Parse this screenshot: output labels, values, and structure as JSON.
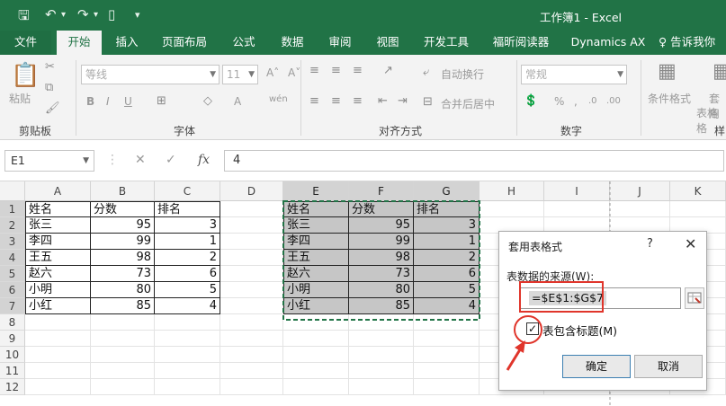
{
  "window": {
    "title": "工作簿1 - Excel"
  },
  "tabs": [
    {
      "label": "文件",
      "active": false,
      "file": true
    },
    {
      "label": "开始",
      "active": true
    },
    {
      "label": "插入"
    },
    {
      "label": "页面布局"
    },
    {
      "label": "公式"
    },
    {
      "label": "数据"
    },
    {
      "label": "审阅"
    },
    {
      "label": "视图"
    },
    {
      "label": "开发工具"
    },
    {
      "label": "福昕阅读器"
    },
    {
      "label": "Dynamics AX"
    },
    {
      "label": "♀ 告诉我你"
    }
  ],
  "ribbon": {
    "clipboard": {
      "paste_label": "粘贴",
      "group_label": "剪贴板"
    },
    "font": {
      "family": "等线",
      "size": "11",
      "group_label": "字体"
    },
    "alignment": {
      "wrap_label": "自动换行",
      "merge_label": "合并后居中",
      "group_label": "对齐方式"
    },
    "number": {
      "format": "常规",
      "group_label": "数字"
    },
    "styles": {
      "cond_label": "条件格式",
      "table_label": "套用",
      "table_label2": "表格格",
      "group_label": "样"
    }
  },
  "formula_bar": {
    "name_box": "E1",
    "fx": "fx",
    "value": "4"
  },
  "columns": [
    "A",
    "B",
    "C",
    "D",
    "E",
    "F",
    "G",
    "H",
    "I",
    "J",
    "K"
  ],
  "rows": [
    "1",
    "2",
    "3",
    "4",
    "5",
    "6",
    "7",
    "8",
    "9",
    "10",
    "11",
    "12"
  ],
  "table_left": {
    "headers": [
      "姓名",
      "分数",
      "排名"
    ],
    "rows": [
      [
        "张三",
        "95",
        "3"
      ],
      [
        "李四",
        "99",
        "1"
      ],
      [
        "王五",
        "98",
        "2"
      ],
      [
        "赵六",
        "73",
        "6"
      ],
      [
        "小明",
        "80",
        "5"
      ],
      [
        "小红",
        "85",
        "4"
      ]
    ]
  },
  "table_right": {
    "headers": [
      "姓名",
      "分数",
      "排名"
    ],
    "rows": [
      [
        "张三",
        "95",
        "3"
      ],
      [
        "李四",
        "99",
        "1"
      ],
      [
        "王五",
        "98",
        "2"
      ],
      [
        "赵六",
        "73",
        "6"
      ],
      [
        "小明",
        "80",
        "5"
      ],
      [
        "小红",
        "85",
        "4"
      ]
    ]
  },
  "dialog": {
    "title": "套用表格式",
    "help": "?",
    "close": "✕",
    "source_label": "表数据的来源(W):",
    "source_value": "=$E$1:$G$7",
    "has_headers_label": "表包含标题(M)",
    "has_headers_checked": true,
    "ok_label": "确定",
    "cancel_label": "取消"
  },
  "colors": {
    "excel_green": "#217346",
    "annotation_red": "#e0352b",
    "selection_gray": "#c6c6c6"
  },
  "icons": [
    "save-icon",
    "undo-icon",
    "redo-icon",
    "new-icon",
    "customize-icon",
    "cut-icon",
    "copy-icon",
    "format-painter-icon",
    "bold-icon",
    "italic-icon",
    "underline-icon",
    "border-icon",
    "fill-color-icon",
    "font-color-icon",
    "align-icon",
    "wrap-icon",
    "merge-icon",
    "percent-icon",
    "conditional-format-icon",
    "cancel-icon",
    "enter-icon",
    "fx-icon",
    "range-picker-icon",
    "checkbox-icon",
    "arrow-annotation-icon"
  ]
}
